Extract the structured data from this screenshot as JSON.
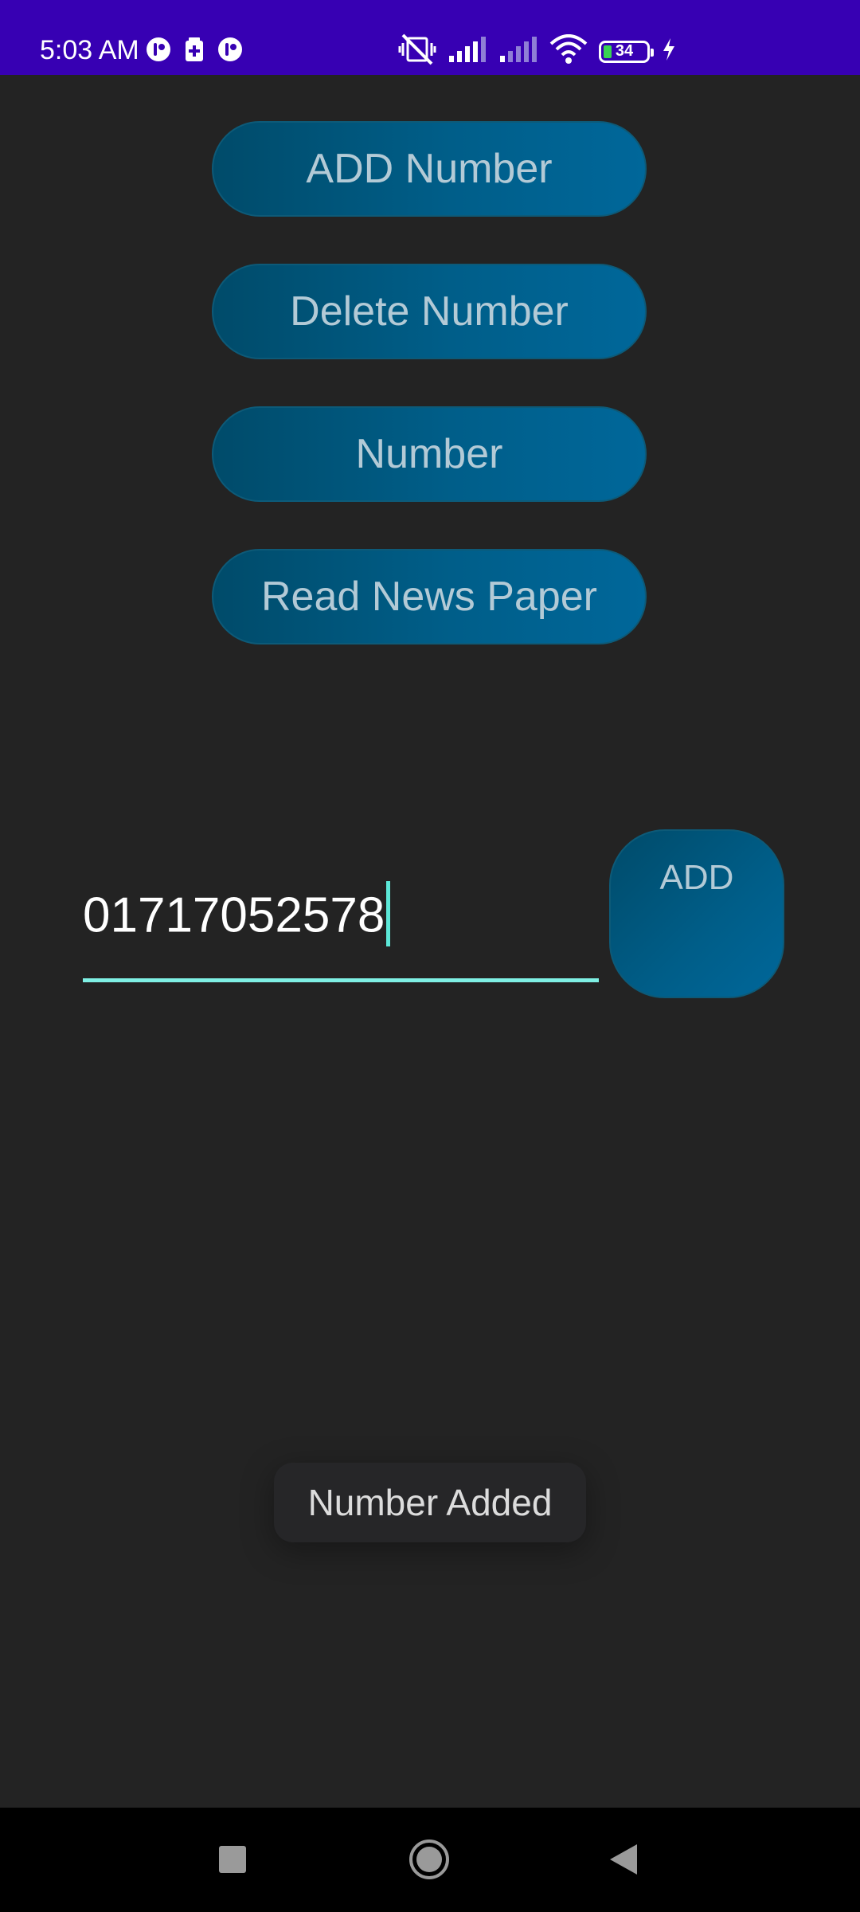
{
  "status_bar": {
    "time": "5:03 AM",
    "battery_level": "34",
    "background_color": "#3700b3",
    "left_icons": [
      "app-notification-icon",
      "sim-toolkit-icon",
      "app-notification-icon"
    ],
    "right_icons": [
      "vibrate-off-icon",
      "signal-icon",
      "signal-icon",
      "wifi-icon",
      "battery-icon",
      "charging-icon"
    ]
  },
  "buttons": {
    "add_number": "ADD Number",
    "delete_number": "Delete Number",
    "number": "Number",
    "read_news_paper": "Read News Paper",
    "add": "ADD"
  },
  "phone_input": {
    "value": "01717052578",
    "accent_color": "#7ff0e4"
  },
  "toast": {
    "message": "Number Added"
  },
  "navigation_bar": {
    "icons": [
      "recents-icon",
      "home-icon",
      "back-icon"
    ]
  },
  "colors": {
    "background": "#232323",
    "button_gradient_start": "#004b6a",
    "button_gradient_end": "#00679a",
    "button_text": "#b3cad6"
  }
}
